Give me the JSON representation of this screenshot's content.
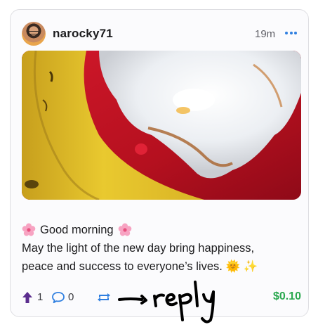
{
  "post": {
    "author": "narocky71",
    "timestamp": "19m",
    "text_line1": "Good morning",
    "text_line2": "May the light of the new day bring happiness,",
    "text_line3": "peace and success to everyone’s lives. 🌞 ✨"
  },
  "actions": {
    "upvote_count": "1",
    "comment_count": "0",
    "payout": "$0.10"
  },
  "annotation": {
    "handwritten_text": "reply"
  },
  "icons": {
    "upvote": "arrow-up-icon",
    "comment": "speech-bubble-icon",
    "repost": "repost-arrows-icon",
    "more": "ellipsis-icon",
    "flower": "cherry-blossom-icon"
  },
  "colors": {
    "accent_blue": "#2f7fe0",
    "upvote_purple": "#5b2d8e",
    "payout_green": "#2aa84f"
  }
}
